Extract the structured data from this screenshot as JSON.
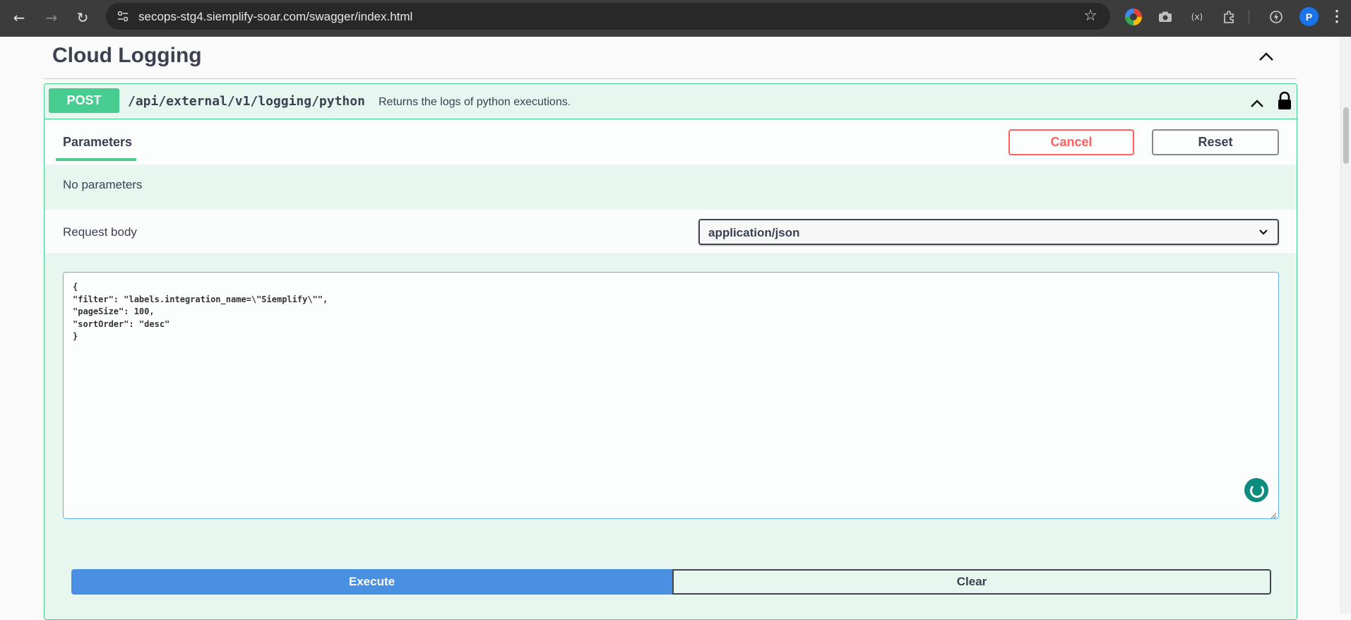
{
  "browser": {
    "url": "secops-stg4.siemplify-soar.com/swagger/index.html",
    "back_icon": "←",
    "forward_icon": "→",
    "reload_icon": "↻",
    "profile_initial": "P"
  },
  "section": {
    "title": "Cloud Logging"
  },
  "operation": {
    "method": "POST",
    "path": "/api/external/v1/logging/python",
    "description": "Returns the logs of python executions.",
    "tab_parameters": "Parameters",
    "cancel_label": "Cancel",
    "reset_label": "Reset",
    "no_parameters": "No parameters",
    "request_body_label": "Request body",
    "content_type": "application/json",
    "body_value": "{\n\"filter\": \"labels.integration_name=\\\"Siemplify\\\"\",\n\"pageSize\": 100,\n\"sortOrder\": \"desc\"\n}",
    "execute_label": "Execute",
    "clear_label": "Clear"
  },
  "colors": {
    "post_green": "#49cc90",
    "execute_blue": "#4990e2",
    "cancel_red": "#ff6060"
  }
}
